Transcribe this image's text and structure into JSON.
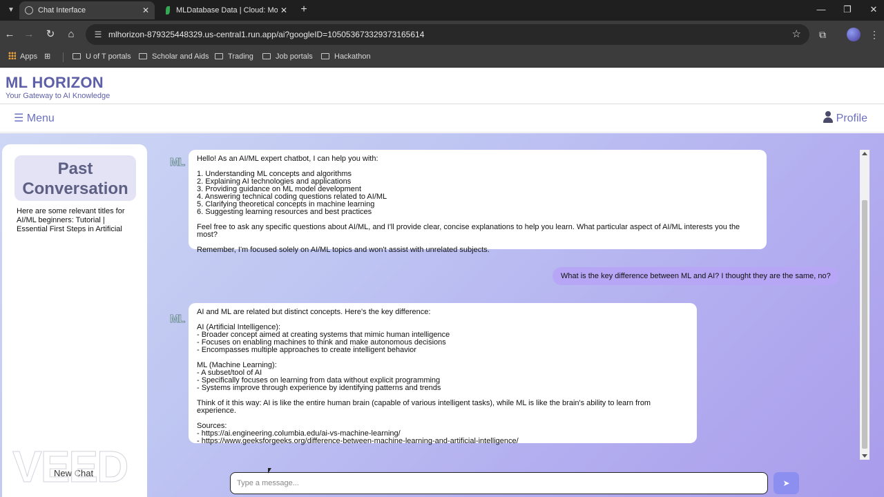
{
  "browser": {
    "tabs": [
      {
        "title": "Chat Interface",
        "active": true
      },
      {
        "title": "MLDatabase Data | Cloud: Mon",
        "active": false
      }
    ],
    "url": "mlhorizon-879325448329.us-central1.run.app/ai?googleID=105053673329373165614",
    "bookmarks": [
      "Apps",
      "U of T portals",
      "Scholar and Aids",
      "Trading",
      "Job portals",
      "Hackathon"
    ]
  },
  "app": {
    "title": "ML HORIZON",
    "subtitle": "Your Gateway to AI Knowledge",
    "menu_label": "☰ Menu",
    "profile_label": "Profile"
  },
  "sidebar": {
    "heading": "Past Conversation",
    "items": [
      "Here are some relevant titles for AI/ML beginners: Tutorial | Essential First Steps in Artificial"
    ],
    "new_chat_label": "New Chat"
  },
  "chat": {
    "bot_avatar": "ML",
    "messages": [
      {
        "role": "bot",
        "text": "Hello! As an AI/ML expert chatbot, I can help you with:\n\n1. Understanding ML concepts and algorithms\n2. Explaining AI technologies and applications\n3. Providing guidance on ML model development\n4. Answering technical coding questions related to AI/ML\n5. Clarifying theoretical concepts in machine learning\n6. Suggesting learning resources and best practices\n\nFeel free to ask any specific questions about AI/ML, and I'll provide clear, concise explanations to help you learn. What particular aspect of AI/ML interests you the most?\n\nRemember, I'm focused solely on AI/ML topics and won't assist with unrelated subjects."
      },
      {
        "role": "user",
        "text": "What is the key difference between ML and AI? I thought they are the same, no?"
      },
      {
        "role": "bot",
        "text": "AI and ML are related but distinct concepts. Here's the key difference:\n\nAI (Artificial Intelligence):\n- Broader concept aimed at creating systems that mimic human intelligence\n- Focuses on enabling machines to think and make autonomous decisions\n- Encompasses multiple approaches to create intelligent behavior\n\nML (Machine Learning):\n- A subset/tool of AI\n- Specifically focuses on learning from data without explicit programming\n- Systems improve through experience by identifying patterns and trends\n\nThink of it this way: AI is like the entire human brain (capable of various intelligent tasks), while ML is like the brain's ability to learn from experience.\n\nSources:\n- https://ai.engineering.columbia.edu/ai-vs-machine-learning/\n- https://www.geeksforgeeks.org/difference-between-machine-learning-and-artificial-intelligence/"
      }
    ],
    "input_placeholder": "Type a message...",
    "send_label": "➤"
  },
  "watermark": "VEED",
  "colors": {
    "brand": "#5d5fa8",
    "accent": "#8d8ff0",
    "user_bubble": "#b6a6f5"
  }
}
